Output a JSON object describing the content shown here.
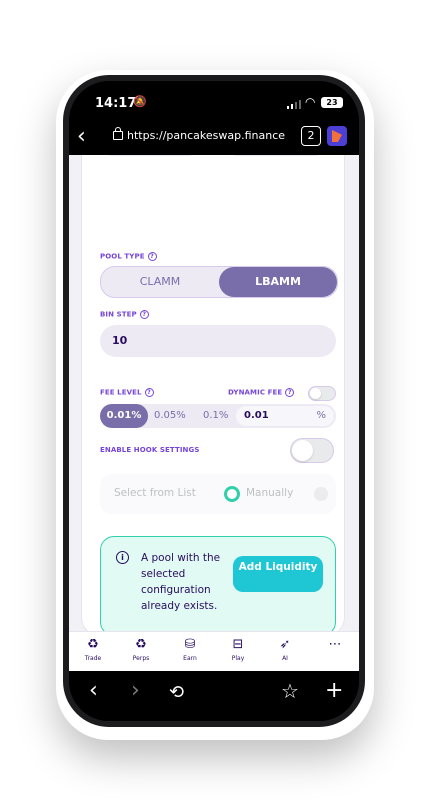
{
  "status_bar": {
    "time": "14:17",
    "battery": "23"
  },
  "browser": {
    "url": "https://pancakeswap.finance",
    "tab_count": "2"
  },
  "pool_type": {
    "label": "POOL TYPE",
    "options": [
      "CLAMM",
      "LBAMM"
    ],
    "selected": "LBAMM"
  },
  "bin_step": {
    "label": "BIN STEP",
    "value": "10"
  },
  "fee_level": {
    "label": "FEE LEVEL",
    "options": [
      "0.01%",
      "0.05%",
      "0.1%"
    ],
    "selected": "0.01%",
    "input_value": "0.01",
    "input_unit": "%"
  },
  "dynamic_fee": {
    "label": "DYNAMIC FEE"
  },
  "hook_settings": {
    "label": "ENABLE HOOK SETTINGS",
    "select_from_list": "Select from List",
    "manually": "Manually"
  },
  "notice": {
    "text": "A pool with the selected configuration already exists.",
    "button": "Add Liquidity"
  },
  "bottom_nav": {
    "items": [
      {
        "label": "Trade",
        "icon": "trade-icon"
      },
      {
        "label": "Perps",
        "icon": "perps-icon"
      },
      {
        "label": "Earn",
        "icon": "earn-icon"
      },
      {
        "label": "Play",
        "icon": "gamepad-icon"
      },
      {
        "label": "AI",
        "icon": "rocket-icon"
      },
      {
        "label": "",
        "icon": "more-icon"
      }
    ]
  },
  "colors": {
    "primary": "#7a6eaa",
    "accent": "#1fc7d4",
    "success": "#31d0aa",
    "text": "#280d5f",
    "label": "#7645d9"
  }
}
